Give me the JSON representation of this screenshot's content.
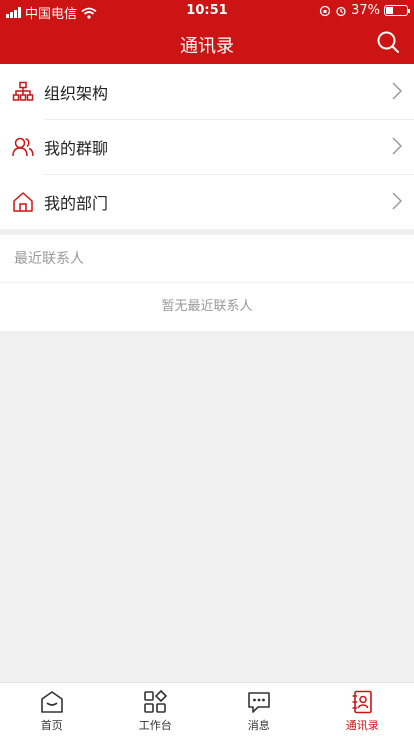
{
  "status_bar": {
    "carrier": "中国电信",
    "time": "10:51",
    "battery": "37%"
  },
  "header": {
    "title": "通讯录",
    "search_icon": "search-icon"
  },
  "menu": [
    {
      "label": "组织架构",
      "icon": "org-chart-icon"
    },
    {
      "label": "我的群聊",
      "icon": "group-icon"
    },
    {
      "label": "我的部门",
      "icon": "home-icon"
    }
  ],
  "recent": {
    "title": "最近联系人",
    "empty_text": "暂无最近联系人"
  },
  "tabs": [
    {
      "label": "首页",
      "icon": "home-tab-icon",
      "active": false
    },
    {
      "label": "工作台",
      "icon": "workbench-icon",
      "active": false
    },
    {
      "label": "消息",
      "icon": "message-icon",
      "active": false
    },
    {
      "label": "通讯录",
      "icon": "contacts-icon",
      "active": true
    }
  ],
  "colors": {
    "brand": "#cc1414",
    "background": "#f0f0f0"
  }
}
